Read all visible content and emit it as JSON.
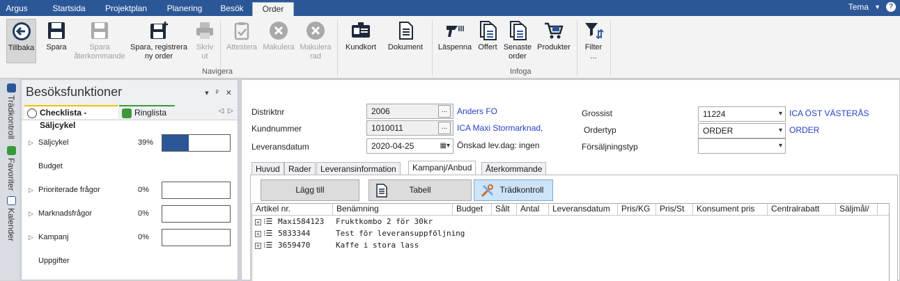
{
  "top_tabs": [
    "Argus",
    "Startsida",
    "Projektplan",
    "Planering",
    "Besök",
    "Order"
  ],
  "active_top_tab": "Order",
  "theme_label": "Tema",
  "ribbon": {
    "buttons": [
      {
        "label": "Tillbaka",
        "icon": "back-arrow-icon"
      },
      {
        "label": "Spara",
        "icon": "save-icon"
      },
      {
        "label": "Spara återkommande",
        "icon": "save-recurring-icon"
      },
      {
        "label": "Spara, registrera ny order",
        "icon": "save-new-icon"
      },
      {
        "label": "Skriv ut",
        "icon": "print-icon"
      },
      {
        "label": "Attestera",
        "icon": "attest-icon"
      },
      {
        "label": "Makulera",
        "icon": "void-icon"
      },
      {
        "label": "Makulera rad",
        "icon": "void-row-icon"
      },
      {
        "label": "Kundkort",
        "icon": "customer-card-icon"
      },
      {
        "label": "Dokument",
        "icon": "document-icon"
      },
      {
        "label": "Läspenna",
        "icon": "scanner-icon"
      },
      {
        "label": "Offert",
        "icon": "quote-icon"
      },
      {
        "label": "Senaste order",
        "icon": "latest-order-icon"
      },
      {
        "label": "Produkter",
        "icon": "cart-icon"
      },
      {
        "label": "Filter ...",
        "icon": "filter-icon"
      }
    ],
    "labels": {
      "tillbaka": "Tillbaka",
      "spara": "Spara",
      "spara_aterk_1": "Spara",
      "spara_aterk_2": "återkommande",
      "spara_reg_1": "Spara, registrera",
      "spara_reg_2": "ny order",
      "skriv_1": "Skriv",
      "skriv_2": "ut",
      "attestera": "Attestera",
      "makulera": "Makulera",
      "makulera_rad_1": "Makulera",
      "makulera_rad_2": "rad",
      "kundkort": "Kundkort",
      "dokument": "Dokument",
      "laspenna": "Läspenna",
      "offert": "Offert",
      "senaste_1": "Senaste",
      "senaste_2": "order",
      "produkter": "Produkter",
      "filter_1": "Filter",
      "filter_2": "..."
    },
    "groups": {
      "navigera": "Navigera",
      "infoga": "Infoga"
    }
  },
  "vertical_tabs": {
    "tradkontroll": "Trädkontroll",
    "favoriter": "Favoriter",
    "kalender": "Kalender"
  },
  "left_panel": {
    "title": "Besöksfunktioner",
    "controls": {
      "dropdown": "▾",
      "pin": "ᵖ",
      "close": "✕"
    },
    "tabs": {
      "checklista": "Checklista - Säljcykel",
      "ringlista": "Ringlista"
    },
    "items": [
      {
        "name": "Säljcykel",
        "percent": "39%",
        "progress": 0.39,
        "has_arrow": true,
        "has_bar": true
      },
      {
        "name": "Budget",
        "percent": "",
        "has_arrow": false,
        "has_bar": false
      },
      {
        "name": "Prioriterade frågor",
        "percent": "0%",
        "progress": 0,
        "has_arrow": true,
        "has_bar": true
      },
      {
        "name": "Marknadsfrågor",
        "percent": "0%",
        "progress": 0,
        "has_arrow": true,
        "has_bar": true
      },
      {
        "name": "Kampanj",
        "percent": "0%",
        "progress": 0,
        "has_arrow": true,
        "has_bar": true
      },
      {
        "name": "Uppgifter",
        "percent": "",
        "has_arrow": false,
        "has_bar": false
      }
    ]
  },
  "form": {
    "distriktnr_label": "Distriktnr",
    "distriktnr_value": "2006",
    "distriktnr_name": "Anders FO",
    "kundnummer_label": "Kundnummer",
    "kundnummer_value": "1010011",
    "kundnummer_name": "ICA Maxi Stormarknad,",
    "leveransdatum_label": "Leveransdatum",
    "leveransdatum_value": "2020-04-25",
    "onskad_lev": "Önskad lev.dag: ingen",
    "grossist_label": "Grossist",
    "grossist_value": "11224",
    "grossist_name": "ICA ÖST VÄSTERÅS",
    "ordertyp_label": "Ordertyp",
    "ordertyp_value": "ORDER",
    "ordertyp_name": "ORDER",
    "forsaljningstyp_label": "Försäljningstyp",
    "forsaljningstyp_value": "",
    "dots": "..."
  },
  "content_tabs": [
    "Huvud",
    "Rader",
    "Leveransinformation",
    "Kampanj/Anbud",
    "Återkommande"
  ],
  "active_content_tab": "Kampanj/Anbud",
  "action_buttons": {
    "lagg_till": "Lägg till",
    "tabell": "Tabell",
    "tradkontroll": "Trädkontroll"
  },
  "grid": {
    "columns": [
      "Artikel nr.",
      "Benämning",
      "Budget",
      "Sålt",
      "Antal",
      "Leveransdatum",
      "Pris/KG",
      "Pris/St",
      "Konsument pris",
      "Centralrabatt",
      "Säljmål/"
    ],
    "rows": [
      {
        "artikel": "Maxi584123",
        "benamning": "Fruktkombo 2 för 30kr"
      },
      {
        "artikel": "5833344",
        "benamning": "Test för leveransuppföljning"
      },
      {
        "artikel": "3659470",
        "benamning": "Kaffe i stora lass"
      }
    ]
  },
  "colors": {
    "accent": "#2b5797",
    "link": "#2340c8",
    "progress_fill": "#2b5797"
  }
}
